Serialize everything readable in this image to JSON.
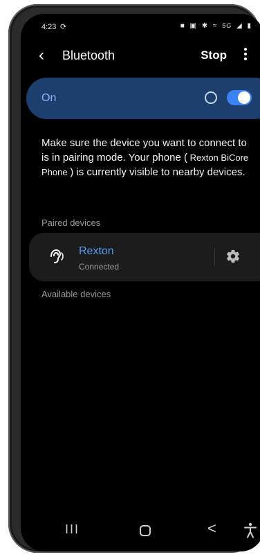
{
  "status_bar": {
    "time": "4:23",
    "sync_icon": "sync-icon",
    "icons": [
      "alarm-icon",
      "nfc-icon",
      "bluetooth-icon",
      "wifi-icon",
      "signal-icon",
      "battery-icon"
    ],
    "network": "5G"
  },
  "app_bar": {
    "title": "Bluetooth",
    "stop_label": "Stop"
  },
  "master_switch": {
    "label": "On",
    "enabled": true,
    "accent": "#3b82f6",
    "bar_color": "#1d3f6d"
  },
  "description": {
    "text_before": "Make sure the device you want to connect to is in pairing mode. Your phone (",
    "phone_name": " Rexton BiCore Phone ",
    "text_after": ") is currently visible to nearby devices."
  },
  "paired": {
    "heading": "Paired devices",
    "devices": [
      {
        "name": "Rexton",
        "status": "Connected",
        "icon": "hearing-aid-icon"
      }
    ]
  },
  "available": {
    "heading": "Available devices"
  },
  "nav_bar": {
    "recents_glyph": "III",
    "back_glyph": "<",
    "accessibility_icon": "accessibility-icon"
  }
}
